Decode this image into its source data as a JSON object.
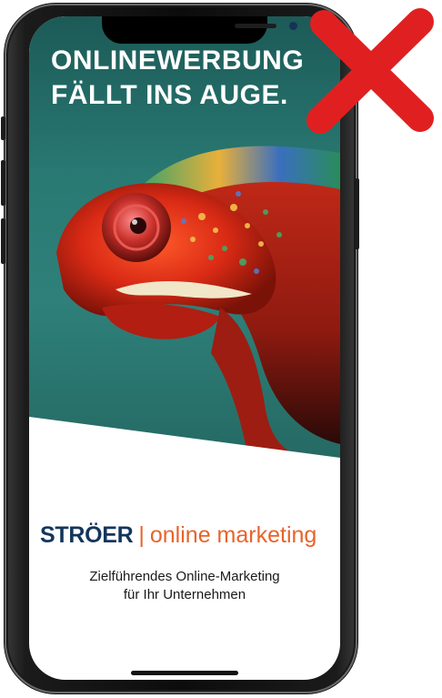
{
  "ad": {
    "headline_line1": "ONLINEWERBUNG",
    "headline_line2": "FÄLLT INS AUGE.",
    "background_color": "#2a7a74"
  },
  "brand": {
    "logo_name": "STRÖER",
    "separator": "|",
    "logo_suffix": "online marketing",
    "name_color": "#14365c",
    "accent_color": "#e8632b"
  },
  "tagline": {
    "line1": "Zielführendes Online-Marketing",
    "line2": "für Ihr Unternehmen"
  },
  "overlay": {
    "icon": "red-cross-icon",
    "color": "#e02020"
  }
}
